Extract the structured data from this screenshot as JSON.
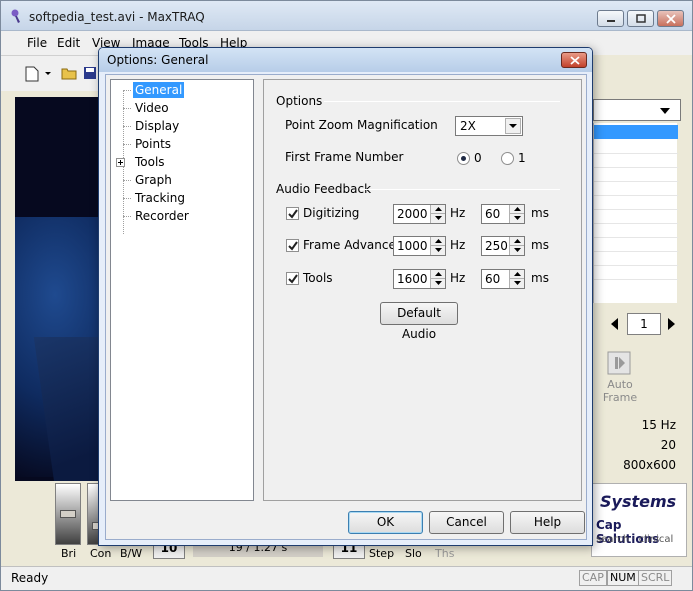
{
  "main_window": {
    "title": "softpedia_test.avi - MaxTRAQ",
    "menu": [
      "File",
      "Edit",
      "View",
      "Image",
      "Tools",
      "Help"
    ],
    "frame_number": "1",
    "auto_frame_label": "Auto Frame",
    "info": {
      "rate": "15 Hz",
      "count": "20",
      "resolution": "800x600"
    },
    "logo": {
      "brand": "Systems",
      "tagline": "Cap Solutions",
      "sub": "search · clinical"
    },
    "bottom": {
      "bri_label": "Bri",
      "con_label": "Con",
      "bw_label": "B/W",
      "left_box": "10",
      "time": "19 /  1.27 s",
      "right_box": "11",
      "step_label": "Step",
      "slo_label": "Slo",
      "ths_label": "Ths"
    },
    "status": {
      "text": "Ready",
      "cap": "CAP",
      "num": "NUM",
      "scrl": "SCRL"
    }
  },
  "dialog": {
    "title": "Options: General",
    "tree": [
      "General",
      "Video",
      "Display",
      "Points",
      "Tools",
      "Graph",
      "Tracking",
      "Recorder"
    ],
    "options_group": "Options",
    "zoom_label": "Point Zoom Magnification",
    "zoom_value": "2X",
    "first_frame_label": "First Frame Number",
    "radio_0": "0",
    "radio_1": "1",
    "audio_group": "Audio Feedback",
    "audio": [
      {
        "label": "Digitizing",
        "hz": "2000",
        "ms": "60"
      },
      {
        "label": "Frame Advance",
        "hz": "1000",
        "ms": "250"
      },
      {
        "label": "Tools",
        "hz": "1600",
        "ms": "60"
      }
    ],
    "hz_unit": "Hz",
    "ms_unit": "ms",
    "default_audio": "Default Audio",
    "ok": "OK",
    "cancel": "Cancel",
    "help": "Help"
  },
  "colors": {
    "selection": "#3399ff",
    "title_gradient_top": "#d3e3f5",
    "close_red": "#c2412b"
  }
}
